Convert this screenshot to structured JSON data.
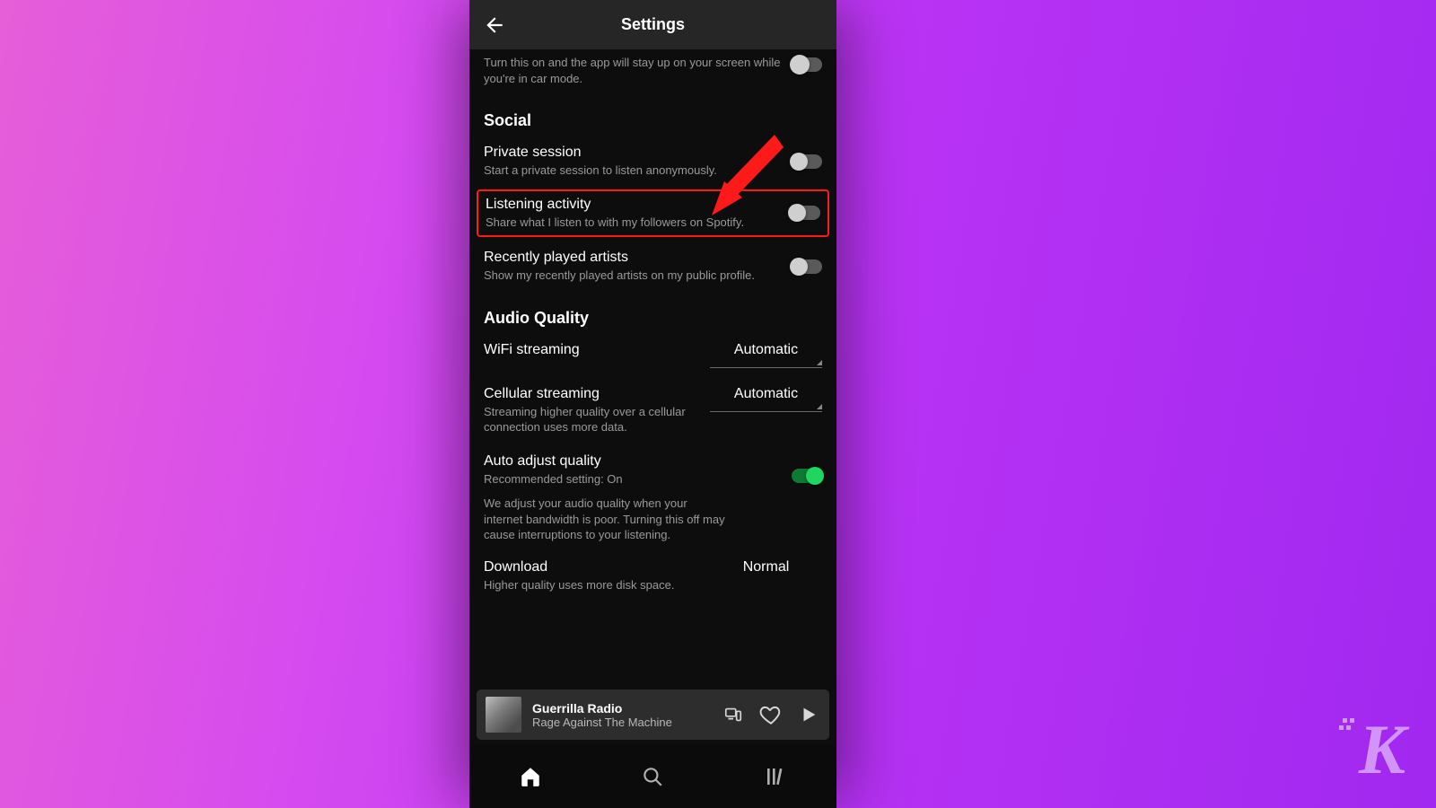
{
  "header": {
    "title": "Settings"
  },
  "cutoff": {
    "desc": "Turn this on and the app will stay up on your screen while you're in car mode."
  },
  "social": {
    "heading": "Social",
    "private": {
      "title": "Private session",
      "desc": "Start a private session to listen anonymously."
    },
    "listening": {
      "title": "Listening activity",
      "desc": "Share what I listen to with my followers on Spotify."
    },
    "recent": {
      "title": "Recently played artists",
      "desc": "Show my recently played artists on my public profile."
    }
  },
  "audio": {
    "heading": "Audio Quality",
    "wifi": {
      "title": "WiFi streaming",
      "value": "Automatic"
    },
    "cellular": {
      "title": "Cellular streaming",
      "desc": "Streaming higher quality over a cellular connection uses more data.",
      "value": "Automatic"
    },
    "auto": {
      "title": "Auto adjust quality",
      "rec": "Recommended setting: On",
      "note": "We adjust your audio quality when your internet bandwidth is poor. Turning this off may cause interruptions to your listening."
    },
    "download": {
      "title": "Download",
      "desc": "Higher quality uses more disk space.",
      "value": "Normal"
    }
  },
  "now_playing": {
    "title": "Guerrilla Radio",
    "artist": "Rage Against The Machine"
  },
  "watermark": "K"
}
